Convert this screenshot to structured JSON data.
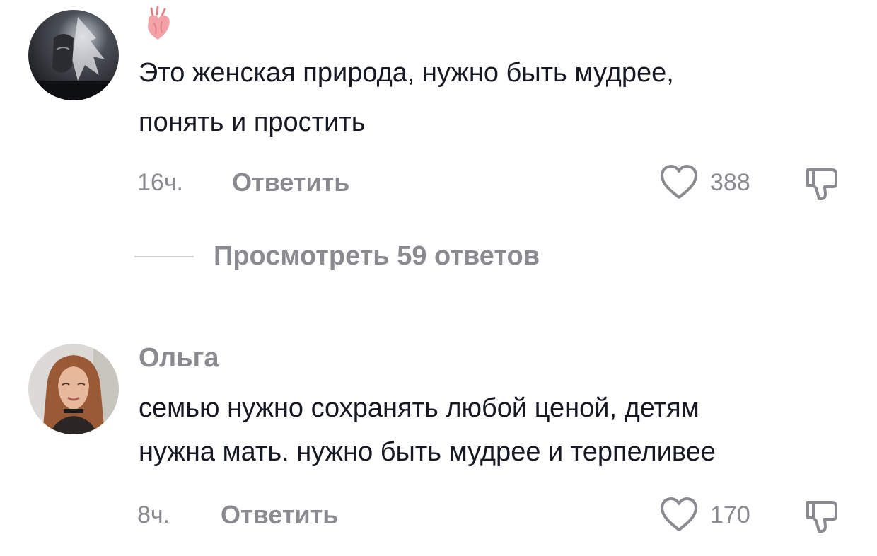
{
  "comments": [
    {
      "username": "",
      "sticker_icon": "anatomical-heart-icon",
      "text_line1": "Это женская природа, нужно быть мудрее,",
      "text_line2": "понять и простить",
      "time": "16ч.",
      "reply_label": "Ответить",
      "like_icon": "heart-outline-icon",
      "likes": "388",
      "dislike_icon": "thumbs-down-icon",
      "view_replies_label": "Просмотреть 59 ответов"
    },
    {
      "username": "Ольга",
      "text_line1": "семью нужно сохранять любой ценой, детям",
      "text_line2": "нужна мать. нужно быть мудрее и терпеливее",
      "time": "8ч.",
      "reply_label": "Ответить",
      "like_icon": "heart-outline-icon",
      "likes": "170",
      "dislike_icon": "thumbs-down-icon"
    }
  ],
  "colors": {
    "text_primary": "#161823",
    "text_secondary": "#8a8b91",
    "divider": "#d0d1d3",
    "sticker_heart": "#f3a3a8"
  }
}
